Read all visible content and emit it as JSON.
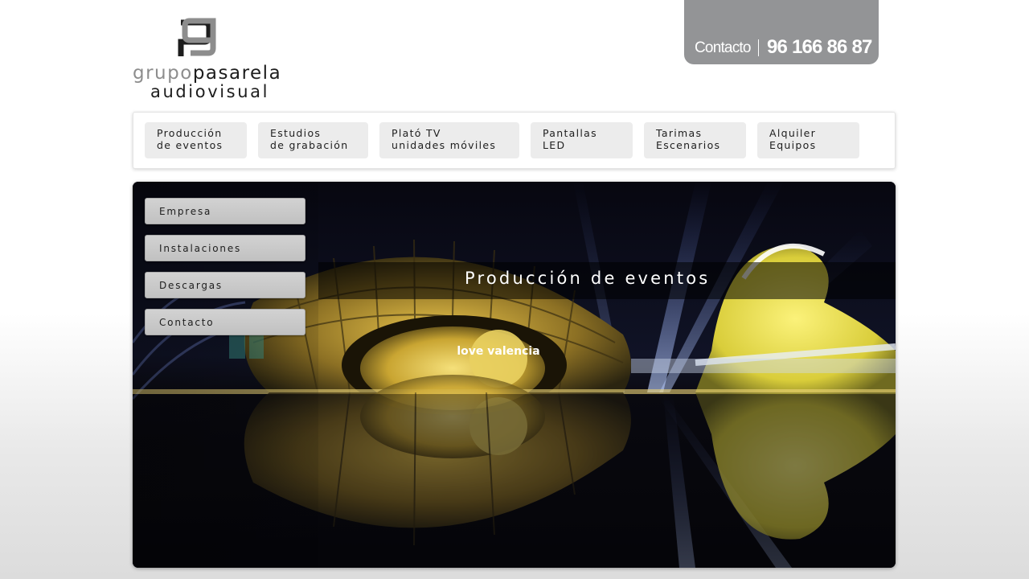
{
  "logo": {
    "monogram": "gp",
    "word_grey": "grupo",
    "word_dark": "pasarela",
    "line2": "audiovisual"
  },
  "header": {
    "contact_label": "Contacto",
    "phone": "96 166 86 87",
    "tab_color": "#939496"
  },
  "topnav": {
    "items": [
      {
        "line1": "Producción",
        "line2": "de eventos"
      },
      {
        "line1": "Estudios",
        "line2": "de grabación"
      },
      {
        "line1": "Plató TV",
        "line2": "unidades móviles"
      },
      {
        "line1": "Pantallas",
        "line2": "LED"
      },
      {
        "line1": "Tarimas",
        "line2": "Escenarios"
      },
      {
        "line1": "Alquiler",
        "line2": "Equipos"
      }
    ]
  },
  "sidemenu": {
    "items": [
      {
        "label": "Empresa"
      },
      {
        "label": "Instalaciones"
      },
      {
        "label": "Descargas"
      },
      {
        "label": "Contacto"
      }
    ]
  },
  "hero": {
    "caption": "Producción de eventos",
    "sign_text": "love valencia"
  }
}
